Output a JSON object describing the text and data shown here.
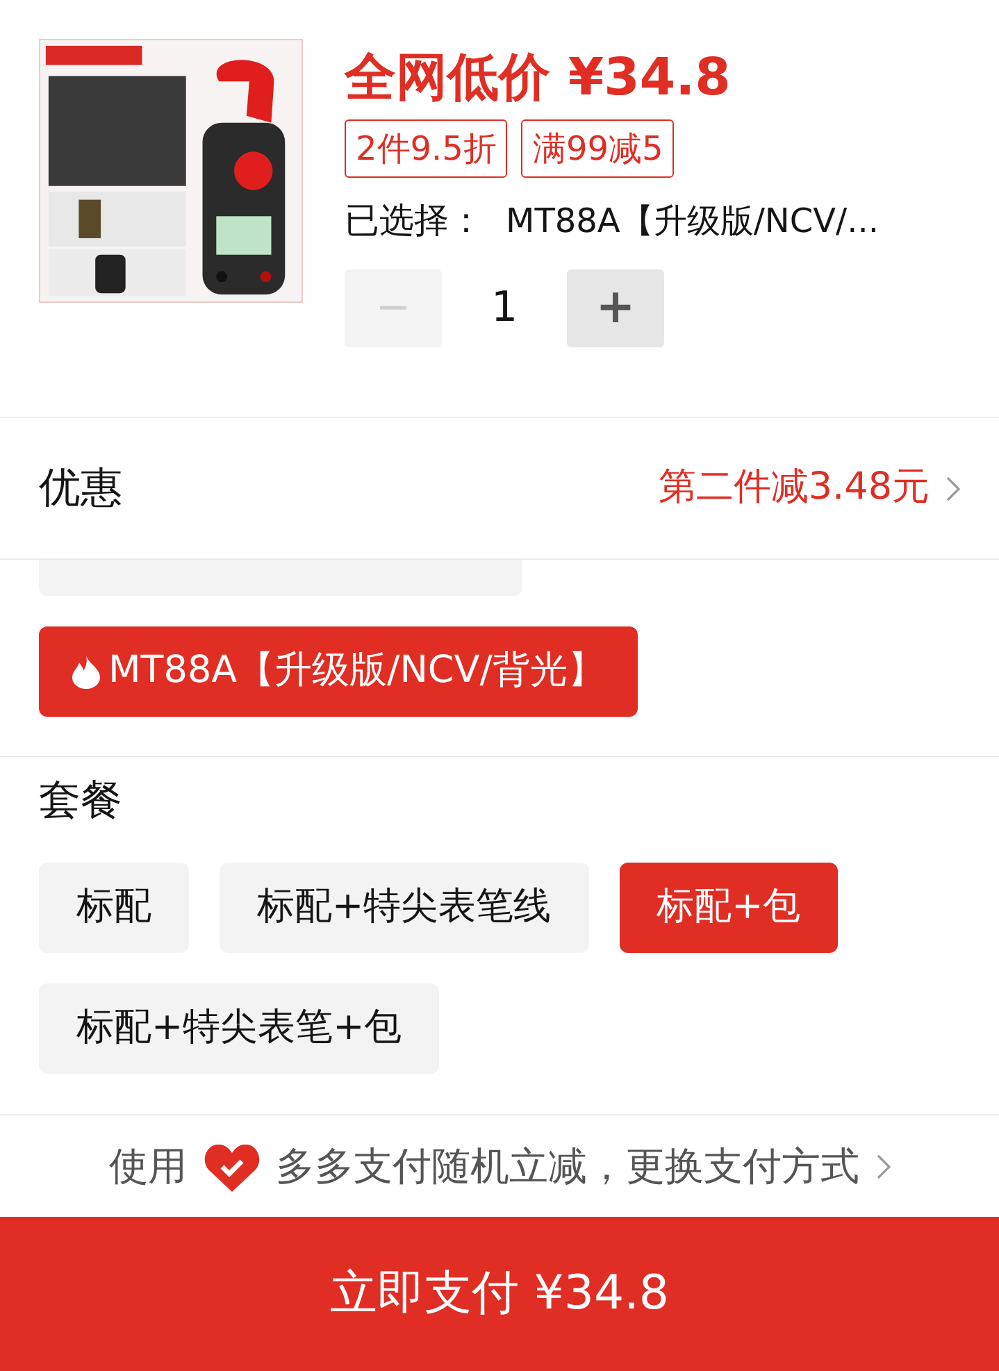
{
  "product": {
    "price_label": "全网低价 ¥34.8",
    "promo_tags": [
      "2件9.5折",
      "满99减5"
    ],
    "selected_label": "已选择：",
    "selected_value": "MT88A【升级版/NCV/...",
    "quantity": {
      "minus": "−",
      "value": "1",
      "plus": "+",
      "minus_disabled": true
    }
  },
  "discount": {
    "label": "优惠",
    "value": "第二件减3.48元"
  },
  "model_options": [
    {
      "label": "MT88A【升级版/NCV/背光】",
      "selected": true,
      "hot": true
    }
  ],
  "package": {
    "title": "套餐",
    "options": [
      {
        "label": "标配",
        "selected": false
      },
      {
        "label": "标配+特尖表笔线",
        "selected": false
      },
      {
        "label": "标配+包",
        "selected": true
      },
      {
        "label": "标配+特尖表笔+包",
        "selected": false
      }
    ]
  },
  "payment": {
    "prefix": "使用",
    "text": "多多支付随机立减，更换支付方式"
  },
  "pay_button": "立即支付 ¥34.8"
}
